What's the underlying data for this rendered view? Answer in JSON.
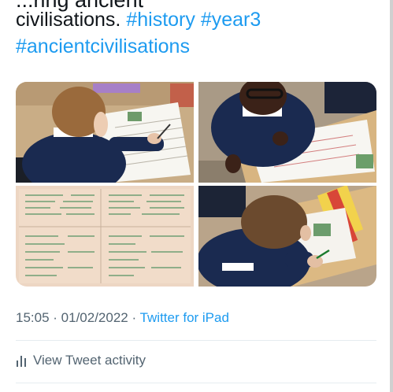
{
  "tweet": {
    "partial_line": "...ring ancient",
    "text_plain": "civilisations. ",
    "hashtags": [
      "#history",
      "#year3",
      "#ancientcivilisations"
    ]
  },
  "media": {
    "photos": [
      {
        "name": "photo-child-writing-1"
      },
      {
        "name": "photo-child-writing-2"
      },
      {
        "name": "photo-notes-poster"
      },
      {
        "name": "photo-child-writing-3"
      }
    ]
  },
  "meta": {
    "time": "15:05",
    "separator1": " · ",
    "date": "01/02/2022",
    "separator2": " · ",
    "source": "Twitter for iPad"
  },
  "actions": {
    "view_activity": "View Tweet activity"
  },
  "icons": {
    "activity": "bar-chart-icon"
  },
  "colors": {
    "link": "#1d9bf0",
    "text": "#0f1419",
    "muted": "#536471"
  }
}
